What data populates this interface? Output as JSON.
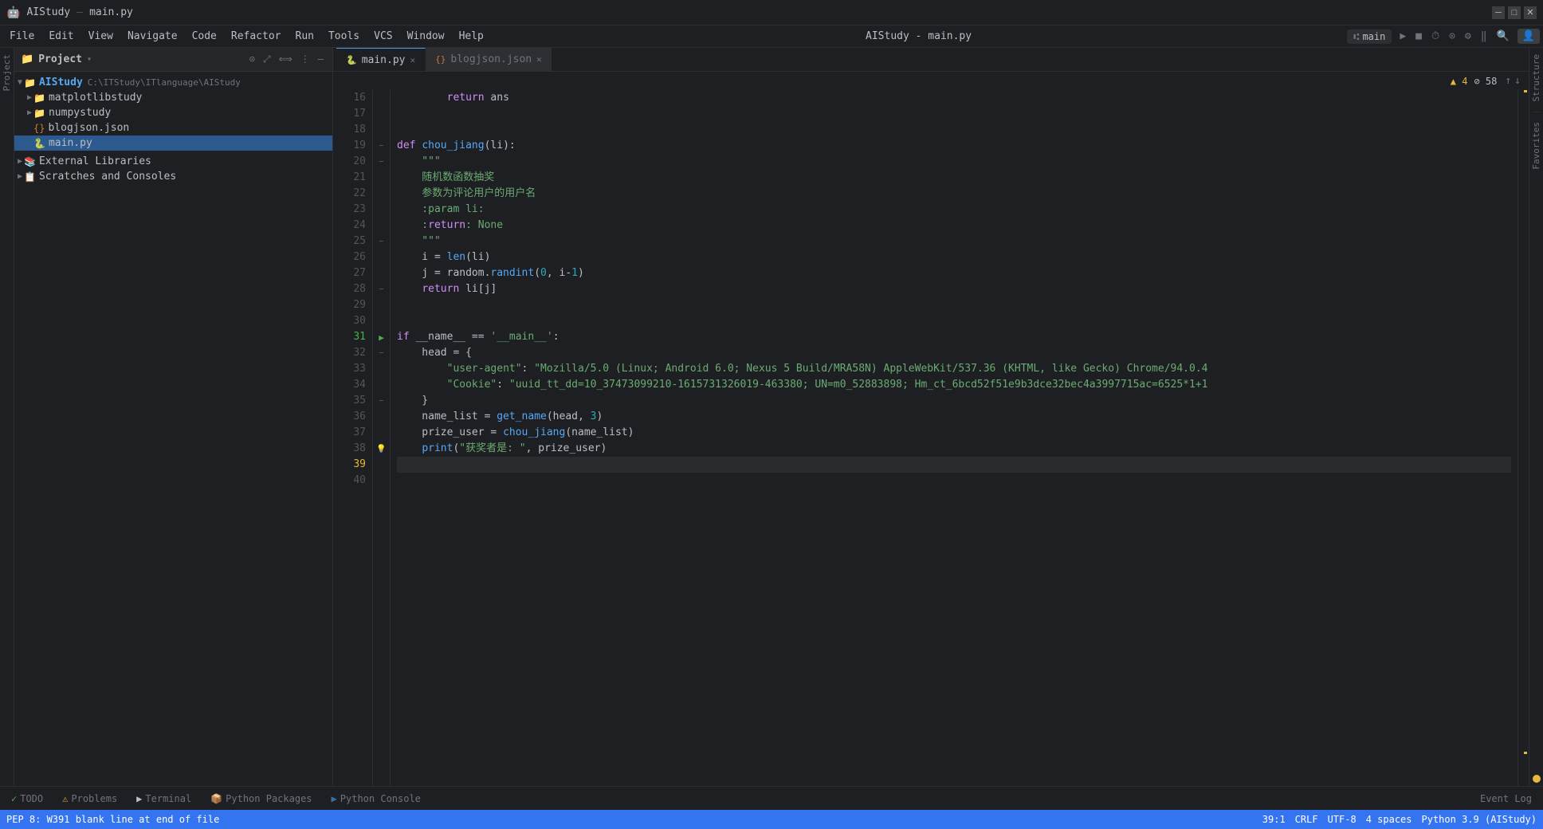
{
  "app": {
    "name": "AIStudy",
    "separator": "–",
    "file": "main.py",
    "title": "AIStudy - main.py"
  },
  "menu": {
    "items": [
      "File",
      "Edit",
      "View",
      "Navigate",
      "Code",
      "Refactor",
      "Run",
      "Tools",
      "VCS",
      "Window",
      "Help"
    ]
  },
  "toolbar": {
    "branch": "main",
    "run_label": "▶",
    "stop_label": "■",
    "search_icon": "🔍",
    "account_icon": "👤"
  },
  "project_panel": {
    "title": "Project",
    "root": {
      "name": "AIStudy",
      "path": "C:\\ITStudy\\ITlanguage\\AIStudy",
      "children": [
        {
          "name": "matplotlibstudy",
          "type": "folder",
          "expanded": false
        },
        {
          "name": "numpystudy",
          "type": "folder",
          "expanded": false
        },
        {
          "name": "blogjson.json",
          "type": "json",
          "expanded": false
        },
        {
          "name": "main.py",
          "type": "python",
          "expanded": false,
          "selected": true
        }
      ]
    },
    "external_libraries": "External Libraries",
    "scratches": "Scratches and Consoles"
  },
  "tabs": [
    {
      "name": "main.py",
      "active": true,
      "icon": "py"
    },
    {
      "name": "blogjson.json",
      "active": false,
      "icon": "json"
    }
  ],
  "editor": {
    "warning_count": "▲ 4",
    "error_count": "⊘ 58",
    "nav_up": "↑",
    "nav_down": "↓"
  },
  "code_lines": [
    {
      "num": 16,
      "content": "        return ans",
      "gutter": ""
    },
    {
      "num": 17,
      "content": "",
      "gutter": ""
    },
    {
      "num": 18,
      "content": "",
      "gutter": ""
    },
    {
      "num": 19,
      "content": "def chou_jiang(li):",
      "gutter": "fold"
    },
    {
      "num": 20,
      "content": "    \"\"\"",
      "gutter": "fold"
    },
    {
      "num": 21,
      "content": "    随机数函数抽奖",
      "gutter": ""
    },
    {
      "num": 22,
      "content": "    参数为评论用户的用户名",
      "gutter": ""
    },
    {
      "num": 23,
      "content": "    :param li:",
      "gutter": ""
    },
    {
      "num": 24,
      "content": "    :return: None",
      "gutter": ""
    },
    {
      "num": 25,
      "content": "    \"\"\"",
      "gutter": "fold"
    },
    {
      "num": 26,
      "content": "    i = len(li)",
      "gutter": ""
    },
    {
      "num": 27,
      "content": "    j = random.randint(0, i-1)",
      "gutter": ""
    },
    {
      "num": 28,
      "content": "    return li[j]",
      "gutter": "fold"
    },
    {
      "num": 29,
      "content": "",
      "gutter": ""
    },
    {
      "num": 30,
      "content": "",
      "gutter": ""
    },
    {
      "num": 31,
      "content": "if __name__ == '__main__':",
      "gutter": "run"
    },
    {
      "num": 32,
      "content": "    head = {",
      "gutter": "fold"
    },
    {
      "num": 33,
      "content": "        \"user-agent\": \"Mozilla/5.0 (Linux; Android 6.0; Nexus 5 Build/MRA58N) AppleWebKit/537.36 (KHTML, like Gecko) Chrome/94.0.4",
      "gutter": ""
    },
    {
      "num": 34,
      "content": "        \"Cookie\": \"uuid_tt_dd=10_37473099210-1615731326019-463380; UN=m0_52883898; Hm_ct_6bcd52f51e9b3dce32bec4a3997715ac=6525*1+1",
      "gutter": ""
    },
    {
      "num": 35,
      "content": "    }",
      "gutter": "fold"
    },
    {
      "num": 36,
      "content": "    name_list = get_name(head, 3)",
      "gutter": ""
    },
    {
      "num": 37,
      "content": "    prize_user = chou_jiang(name_list)",
      "gutter": ""
    },
    {
      "num": 38,
      "content": "    print(\"获奖者是: \", prize_user)",
      "gutter": "warning"
    },
    {
      "num": 39,
      "content": "",
      "gutter": ""
    },
    {
      "num": 40,
      "content": "",
      "gutter": ""
    }
  ],
  "status_bar": {
    "pep8_message": "PEP 8: W391 blank line at end of file",
    "position": "39:1",
    "encoding": "CRLF",
    "charset": "UTF-8",
    "indent": "4 spaces",
    "python_version": "Python 3.9 (AIStudy)"
  },
  "bottom_tabs": [
    {
      "label": "TODO",
      "icon": "✓"
    },
    {
      "label": "Problems",
      "icon": "⚠"
    },
    {
      "label": "Terminal",
      "icon": ">"
    },
    {
      "label": "Python Packages",
      "icon": "📦"
    },
    {
      "label": "Python Console",
      "icon": ">"
    }
  ],
  "right_tabs": {
    "event_log": "Event Log"
  },
  "colors": {
    "accent_blue": "#3574f0",
    "keyword": "#cf8ef4",
    "string": "#6aab73",
    "function": "#56a8f5",
    "number": "#2aacb8",
    "comment_docstring": "#629755",
    "warning": "#e2b93d",
    "run_green": "#4caf50"
  }
}
